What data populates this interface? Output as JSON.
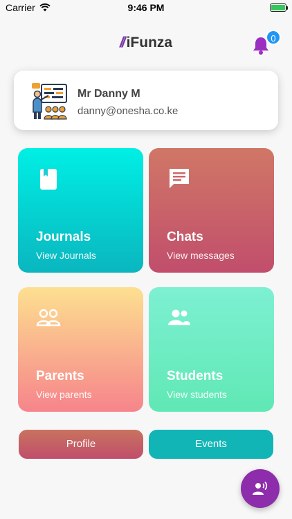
{
  "status_bar": {
    "carrier": "Carrier",
    "time": "9:46 PM",
    "battery_level": 1.0
  },
  "header": {
    "logo_mark": "//",
    "app_name": "iFunza",
    "notification_count": "0"
  },
  "profile": {
    "name": "Mr Danny M",
    "email": "danny@onesha.co.ke"
  },
  "tiles": [
    {
      "title": "Journals",
      "subtitle": "View Journals",
      "icon": "book-icon"
    },
    {
      "title": "Chats",
      "subtitle": "View messages",
      "icon": "chat-icon"
    },
    {
      "title": "Parents",
      "subtitle": "View parents",
      "icon": "parents-icon"
    },
    {
      "title": "Students",
      "subtitle": "View students",
      "icon": "students-icon"
    }
  ],
  "buttons": {
    "profile": "Profile",
    "events": "Events"
  },
  "colors": {
    "accent": "#8d2dab",
    "bell": "#9b2fc0",
    "badge": "#2196f3",
    "journals": "#00d6d6",
    "chats": "#c9606a",
    "parents": "#f9b48d",
    "students": "#6febc4",
    "events": "#11b5b6"
  }
}
